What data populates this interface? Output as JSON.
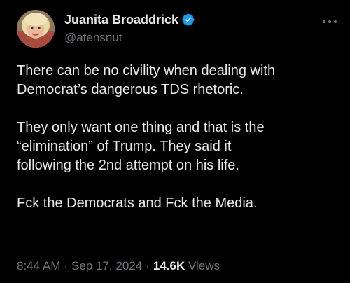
{
  "author": {
    "display_name": "Juanita Broaddrick",
    "handle": "@atensnut",
    "verified": true,
    "avatar_icon": "profile-photo"
  },
  "tweet": {
    "paragraphs": [
      [
        "There can be no civility when dealing with",
        "Democrat’s dangerous TDS rhetoric."
      ],
      [
        "They only want one thing and that is the",
        "“elimination” of Trump.  They said it",
        "following the 2nd attempt on his life."
      ],
      [
        "Fck the Democrats and Fck the Media."
      ]
    ]
  },
  "meta": {
    "time": "8:44 AM",
    "date": "Sep 17, 2024",
    "views_count": "14.6K",
    "views_label": "Views",
    "separator": "·"
  },
  "icons": {
    "verified": "verified-badge-icon",
    "more": "more-options-icon"
  },
  "colors": {
    "background": "#000000",
    "text": "#e7e9ea",
    "secondary": "#71767b",
    "verified": "#1d9bf0"
  }
}
